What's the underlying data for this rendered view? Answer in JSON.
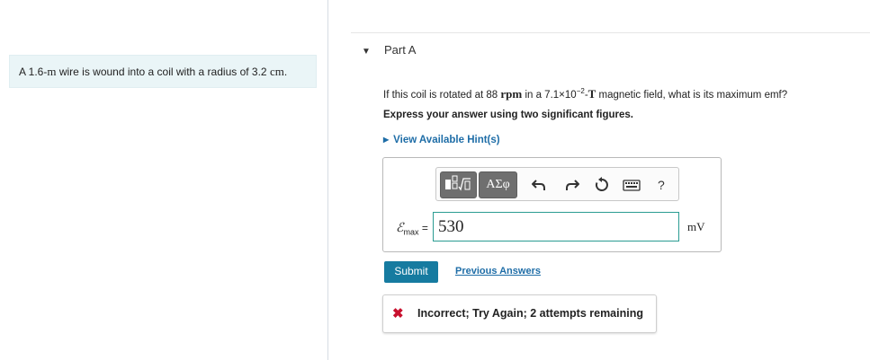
{
  "problem": {
    "text_before": "A 1.6-",
    "length_unit": "m",
    "text_middle": " wire is wound into a coil with a radius of 3.2 ",
    "radius_unit": "cm",
    "text_end": "."
  },
  "part": {
    "title": "Part A"
  },
  "question": {
    "prefix": "If this coil is rotated at 88 ",
    "rpm": "rpm",
    "middle": " in a 7.1×10",
    "exponent": "−2",
    "dash": "-",
    "field_unit": "T",
    "suffix": " magnetic field, what is its maximum emf?"
  },
  "instruction": "Express your answer using two significant figures.",
  "hint_link": "View Available Hint(s)",
  "toolbar": {
    "symbols_label": "ΑΣφ",
    "help_label": "?",
    "icons": [
      "templates-icon",
      "undo-icon",
      "redo-icon",
      "reset-icon",
      "keyboard-icon",
      "help-icon"
    ]
  },
  "answer": {
    "label_symbol": "ℰ",
    "label_subscript": "max",
    "equals": "=",
    "value": "530",
    "unit": "mV"
  },
  "buttons": {
    "submit": "Submit",
    "previous_answers": "Previous Answers"
  },
  "feedback": {
    "icon": "✖",
    "text": "Incorrect; Try Again; 2 attempts remaining"
  },
  "colors": {
    "problem_bg": "#eaf5f7",
    "link": "#1e6da7",
    "submit_bg": "#167ba0",
    "input_border": "#2a9c92",
    "error": "#c8102e"
  }
}
